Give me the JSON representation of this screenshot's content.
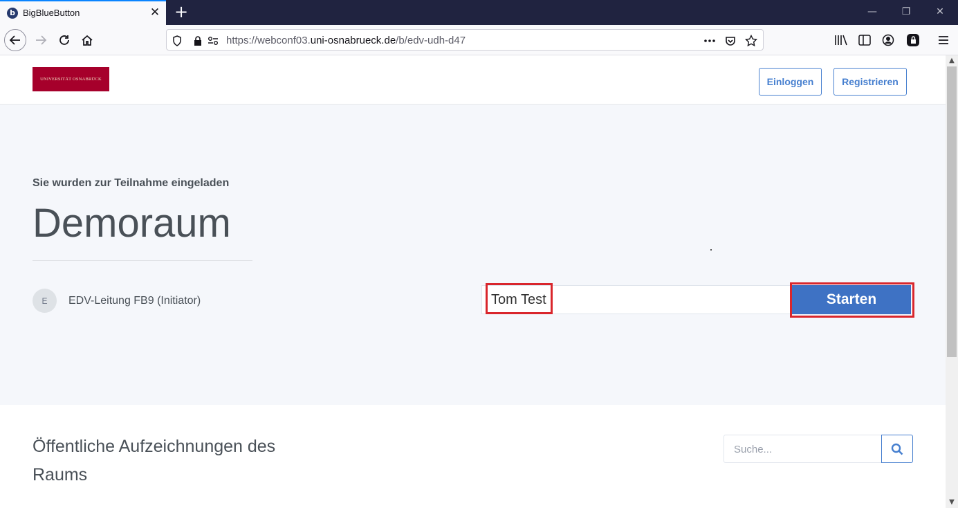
{
  "browser": {
    "tab_title": "BigBlueButton",
    "tab_favicon": "b",
    "url_prefix": "https://webconf03.",
    "url_domain": "uni-osnabrueck.de",
    "url_path": "/b/edv-udh-d47"
  },
  "header": {
    "logo_text": "UNIVERSITÄT  OSNABRÜCK",
    "login_label": "Einloggen",
    "register_label": "Registrieren"
  },
  "hero": {
    "invited_text": "Sie wurden zur Teilnahme eingeladen",
    "room_name": "Demoraum",
    "owner_initial": "E",
    "owner_name": "EDV-Leitung FB9 (Initiator)",
    "name_value": "Tom Test",
    "start_label": "Starten"
  },
  "recordings": {
    "title": "Öffentliche Aufzeichnungen des Raums",
    "search_placeholder": "Suche..."
  },
  "colors": {
    "accent": "#467fcf",
    "start_button": "#3e72c4",
    "highlight": "#d9262c",
    "logo_bg": "#a6002b"
  }
}
